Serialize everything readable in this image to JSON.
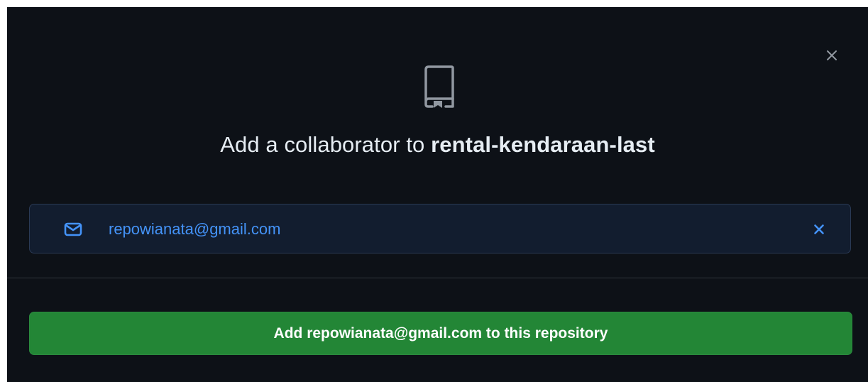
{
  "dialog": {
    "title_prefix": "Add a collaborator to",
    "repo_name": "rental-kendaraan-last",
    "close_icon": "close-icon",
    "header_icon": "repo-icon"
  },
  "selected_collaborator": {
    "icon": "mail-icon",
    "email": "repowianata@gmail.com",
    "remove_icon": "x-icon"
  },
  "submit_button": {
    "label": "Add repowianata@gmail.com to this repository"
  },
  "colors": {
    "background": "#0d1117",
    "text": "#e6edf3",
    "accent_blue": "#4493f8",
    "chip_background": "#121d2f",
    "chip_border": "#2a3a55",
    "button_green": "#238636",
    "divider": "#30363d"
  }
}
